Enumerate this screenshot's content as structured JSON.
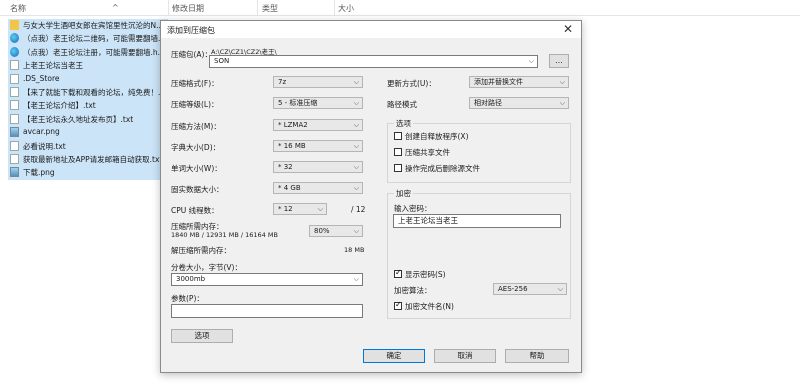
{
  "explorer": {
    "columns": [
      "名称",
      "修改日期",
      "类型",
      "大小"
    ],
    "files": [
      {
        "name": "与女大学生酒吧女郎在宾馆里性沉沦的N...",
        "icon": "folder-icon"
      },
      {
        "name": "（点我）老王论坛二维码，可能需要翻墙...",
        "icon": "edge-icon"
      },
      {
        "name": "（点我）老王论坛注册，可能需要翻墙.h...",
        "icon": "edge-icon"
      },
      {
        "name": "上老王论坛当老王",
        "icon": "doc-icon"
      },
      {
        "name": ".DS_Store",
        "icon": "doc-icon"
      },
      {
        "name": "【来了就能下载和观看的论坛，纯免费！...",
        "icon": "doc-icon"
      },
      {
        "name": "【老王论坛介绍】.txt",
        "icon": "doc-icon"
      },
      {
        "name": "【老王论坛永久地址发布页】.txt",
        "icon": "doc-icon"
      },
      {
        "name": "avcar.png",
        "icon": "image-icon"
      },
      {
        "name": "必看说明.txt",
        "icon": "doc-icon"
      },
      {
        "name": "获取最新地址及APP请发邮箱自动获取.txt",
        "icon": "doc-icon"
      },
      {
        "name": "下载.png",
        "icon": "image-icon"
      }
    ]
  },
  "dialog": {
    "title": "添加到压缩包",
    "close_glyph": "✕",
    "archive_label": "压缩包(A)：",
    "archive_path": "A:\\CZ\\CZ1\\CZ2\\老王\\",
    "archive_name": "SON",
    "browse_label": "...",
    "format_label": "压缩格式(F)：",
    "format_value": "7z",
    "level_label": "压缩等级(L)：",
    "level_value": "5 - 标准压缩",
    "method_label": "压缩方法(M)：",
    "method_value": "* LZMA2",
    "dict_label": "字典大小(D)：",
    "dict_value": "* 16 MB",
    "word_label": "单词大小(W)：",
    "word_value": "* 32",
    "solid_label": "固实数据大小：",
    "solid_value": "* 4 GB",
    "threads_label": "CPU 线程数：",
    "threads_value": "* 12",
    "threads_max": "/ 12",
    "mem_label": "压缩所需内存：",
    "mem_detail": "1840 MB / 12931 MB / 16164 MB",
    "mem_percent": "80%",
    "decomp_label": "解压缩所需内存：",
    "decomp_value": "18 MB",
    "split_label": "分卷大小，字节(V)：",
    "split_value": "3000mb",
    "params_label": "参数(P)：",
    "params_value": "",
    "options_button": "选项",
    "update_label": "更新方式(U)：",
    "update_value": "添加并替换文件",
    "pathmode_label": "路径模式",
    "pathmode_value": "相对路径",
    "options_group": "选项",
    "opt_sfx": "创建自释放程序(X)",
    "opt_shared": "压缩共享文件",
    "opt_delete": "操作完成后删除源文件",
    "encrypt_group": "加密",
    "password_label": "输入密码：",
    "password_value": "上老王论坛当老王",
    "show_password": "显示密码(S)",
    "enc_method_label": "加密算法：",
    "enc_method_value": "AES-256",
    "encrypt_names": "加密文件名(N)",
    "ok_button": "确定",
    "cancel_button": "取消",
    "help_button": "帮助"
  }
}
